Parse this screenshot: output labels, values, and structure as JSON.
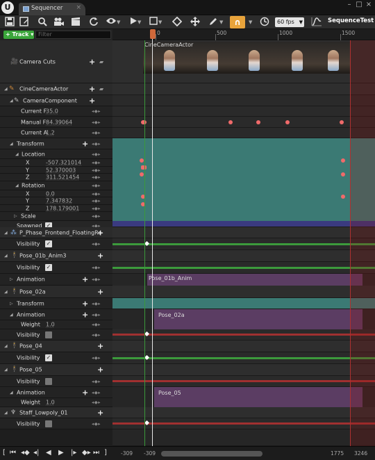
{
  "titlebar": {
    "logo": "U",
    "tab_label": "Sequencer",
    "tab_close": "×",
    "minimize": "–",
    "maximize": "□",
    "close": "×"
  },
  "toolbar": {
    "save_icon": "floppy-icon",
    "save_as_icon": "save-as-icon",
    "find_icon": "magnifier-icon",
    "render_icon": "movie-camera-icon",
    "clapboard_icon": "clapboard-icon",
    "undo_icon": "refresh-icon",
    "fps_value": "60 fps",
    "sequence_name": "SequenceTest",
    "accent_color": "#e8a33b"
  },
  "left": {
    "track_button": "Track",
    "filter_placeholder": "Filter",
    "rows": [
      {
        "label": "Camera Cuts"
      },
      {
        "label": "CineCameraActor"
      },
      {
        "label": "CameraComponent"
      },
      {
        "label": "Current F",
        "value": "35.0"
      },
      {
        "label": "Manual F",
        "value": "84.39064"
      },
      {
        "label": "Current A",
        "value": "1.2"
      },
      {
        "label": "Transform"
      },
      {
        "label": "Location"
      },
      {
        "label": "X",
        "value": "-507.321014"
      },
      {
        "label": "Y",
        "value": "52.370003"
      },
      {
        "label": "Z",
        "value": "311.521454"
      },
      {
        "label": "Rotation"
      },
      {
        "label": "X",
        "value": "0.0"
      },
      {
        "label": "Y",
        "value": "7.347832"
      },
      {
        "label": "Z",
        "value": "178.179001"
      },
      {
        "label": "Scale"
      },
      {
        "label": "Spawned"
      },
      {
        "label": "P_Phase_Frontend_FloatingRo"
      },
      {
        "label": "Visibility"
      },
      {
        "label": "Pose_01b_Anim3"
      },
      {
        "label": "Visibility"
      },
      {
        "label": "Animation"
      },
      {
        "label": "Pose_02a"
      },
      {
        "label": "Transform"
      },
      {
        "label": "Animation"
      },
      {
        "label": "Weight",
        "value": "1.0"
      },
      {
        "label": "Visibility"
      },
      {
        "label": "Pose_04"
      },
      {
        "label": "Visibility"
      },
      {
        "label": "Pose_05"
      },
      {
        "label": "Visibility"
      },
      {
        "label": "Animation"
      },
      {
        "label": "Weight",
        "value": "1.0"
      },
      {
        "label": "Staff_Lowpoly_01"
      },
      {
        "label": "Visibility"
      }
    ]
  },
  "ruler": {
    "labels": [
      "0",
      "500",
      "1000",
      "1500"
    ]
  },
  "sections": {
    "camera_actor": "CineCameraActor",
    "anim_01b": "Pose_01b_Anim",
    "anim_02a": "Pose_02a",
    "anim_05": "Pose_05"
  },
  "bottom": {
    "range_start": "-309",
    "view_start": "-309",
    "view_end": "1775",
    "range_end": "3246"
  }
}
